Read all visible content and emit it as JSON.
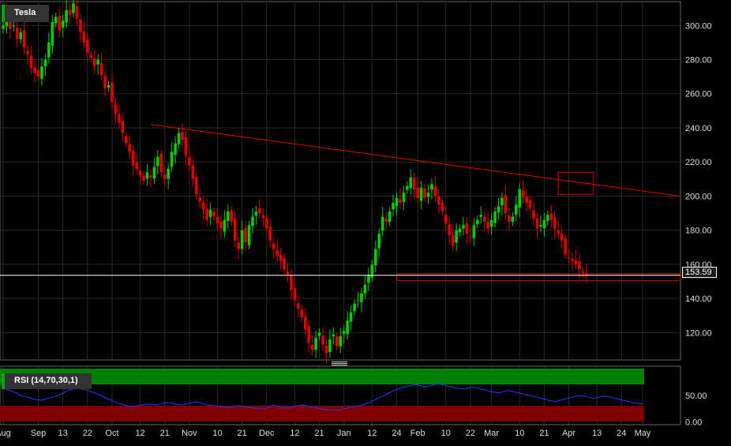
{
  "title": "Tesla",
  "rsi_label": "RSI (14,70,30,1)",
  "last_price_label": "153.59",
  "colors": {
    "up": "#00d000",
    "down": "#e00000",
    "trend": "#e00000",
    "rsi_line": "#1a3cff",
    "overbought": "#008000",
    "oversold": "#800000",
    "grid": "#2a2a2a"
  },
  "chart_data": [
    {
      "type": "candlestick",
      "series_name": "Tesla",
      "y_ticks": [
        "120.00",
        "140.00",
        "160.00",
        "180.00",
        "200.00",
        "220.00",
        "240.00",
        "260.00",
        "280.00",
        "300.00"
      ],
      "y_tick_values": [
        120,
        140,
        160,
        180,
        200,
        220,
        240,
        260,
        280,
        300
      ],
      "ylim": [
        104,
        314
      ],
      "x_ticks": [
        "Aug",
        "Sep",
        "13",
        "22",
        "Oct",
        "12",
        "21",
        "Nov",
        "10",
        "21",
        "Dec",
        "12",
        "21",
        "Jan",
        "12",
        "24",
        "Feb",
        "10",
        "22",
        "Mar",
        "10",
        "21",
        "Apr",
        "13",
        "24",
        "May"
      ],
      "x_tick_index": [
        0,
        10,
        17,
        24,
        31,
        39,
        46,
        53,
        61,
        68,
        75,
        83,
        90,
        97,
        105,
        112,
        118,
        126,
        133,
        139,
        147,
        154,
        161,
        169,
        176,
        182
      ],
      "last_price": 153.59,
      "trendline": {
        "from_index": 42,
        "from_value": 242,
        "to_index": 182,
        "to_value": 200
      },
      "support_zone": [
        150.5,
        154.5
      ],
      "support_zone_from_index": 112,
      "highlight_box": {
        "from_index": 158,
        "to_index": 168,
        "low": 201,
        "high": 214
      },
      "closes": [
        300,
        303,
        298,
        300,
        292,
        296,
        287,
        283,
        275,
        272,
        270,
        276,
        280,
        290,
        302,
        305,
        297,
        303,
        309,
        306,
        313,
        304,
        296,
        290,
        284,
        281,
        276,
        280,
        271,
        263,
        265,
        255,
        248,
        243,
        237,
        231,
        226,
        218,
        216,
        212,
        209,
        214,
        211,
        217,
        223,
        214,
        210,
        216,
        226,
        231,
        237,
        233,
        224,
        218,
        210,
        201,
        197,
        192,
        186,
        192,
        188,
        184,
        181,
        186,
        191,
        185,
        174,
        169,
        180,
        173,
        183,
        188,
        191,
        190,
        187,
        181,
        174,
        169,
        165,
        162,
        157,
        154,
        145,
        139,
        134,
        129,
        122,
        114,
        110,
        117,
        120,
        113,
        108,
        116,
        119,
        112,
        118,
        121,
        127,
        132,
        137,
        139,
        143,
        148,
        154,
        160,
        169,
        178,
        188,
        185,
        191,
        196,
        199,
        196,
        202,
        206,
        211,
        204,
        199,
        205,
        199,
        202,
        207,
        200,
        195,
        191,
        184,
        177,
        171,
        180,
        181,
        183,
        178,
        176,
        183,
        186,
        189,
        185,
        181,
        186,
        191,
        194,
        199,
        190,
        185,
        188,
        195,
        204,
        199,
        196,
        193,
        187,
        181,
        183,
        186,
        189,
        186,
        181,
        178,
        174,
        166,
        164,
        162,
        160,
        157,
        155,
        153.59
      ],
      "rsi": [
        63,
        61,
        58,
        55,
        50,
        48,
        46,
        43,
        42,
        41,
        44,
        46,
        48,
        51,
        55,
        60,
        62,
        64,
        62,
        60,
        58,
        55,
        52,
        48,
        44,
        40,
        37,
        34,
        32,
        30,
        30,
        31,
        32,
        34,
        33,
        32,
        34,
        36,
        37,
        35,
        33,
        32,
        34,
        36,
        38,
        37,
        34,
        32,
        31,
        30,
        29,
        28,
        27,
        29,
        31,
        30,
        28,
        27,
        26,
        25,
        24,
        28,
        32,
        30,
        28,
        26,
        27,
        29,
        31,
        32,
        30,
        28,
        27,
        25,
        24,
        23,
        22,
        22,
        24,
        26,
        28,
        30,
        31,
        33,
        36,
        40,
        44,
        48,
        52,
        56,
        60,
        63,
        66,
        68,
        69,
        70,
        68,
        66,
        68,
        70,
        72,
        70,
        68,
        66,
        64,
        63,
        62,
        64,
        66,
        64,
        62,
        60,
        58,
        56,
        55,
        57,
        59,
        58,
        56,
        54,
        52,
        50,
        48,
        46,
        44,
        42,
        40,
        39,
        41,
        43,
        45,
        47,
        49,
        50,
        48,
        46,
        45,
        47,
        49,
        48,
        46,
        44,
        42,
        40,
        38,
        36,
        35,
        34
      ]
    }
  ]
}
